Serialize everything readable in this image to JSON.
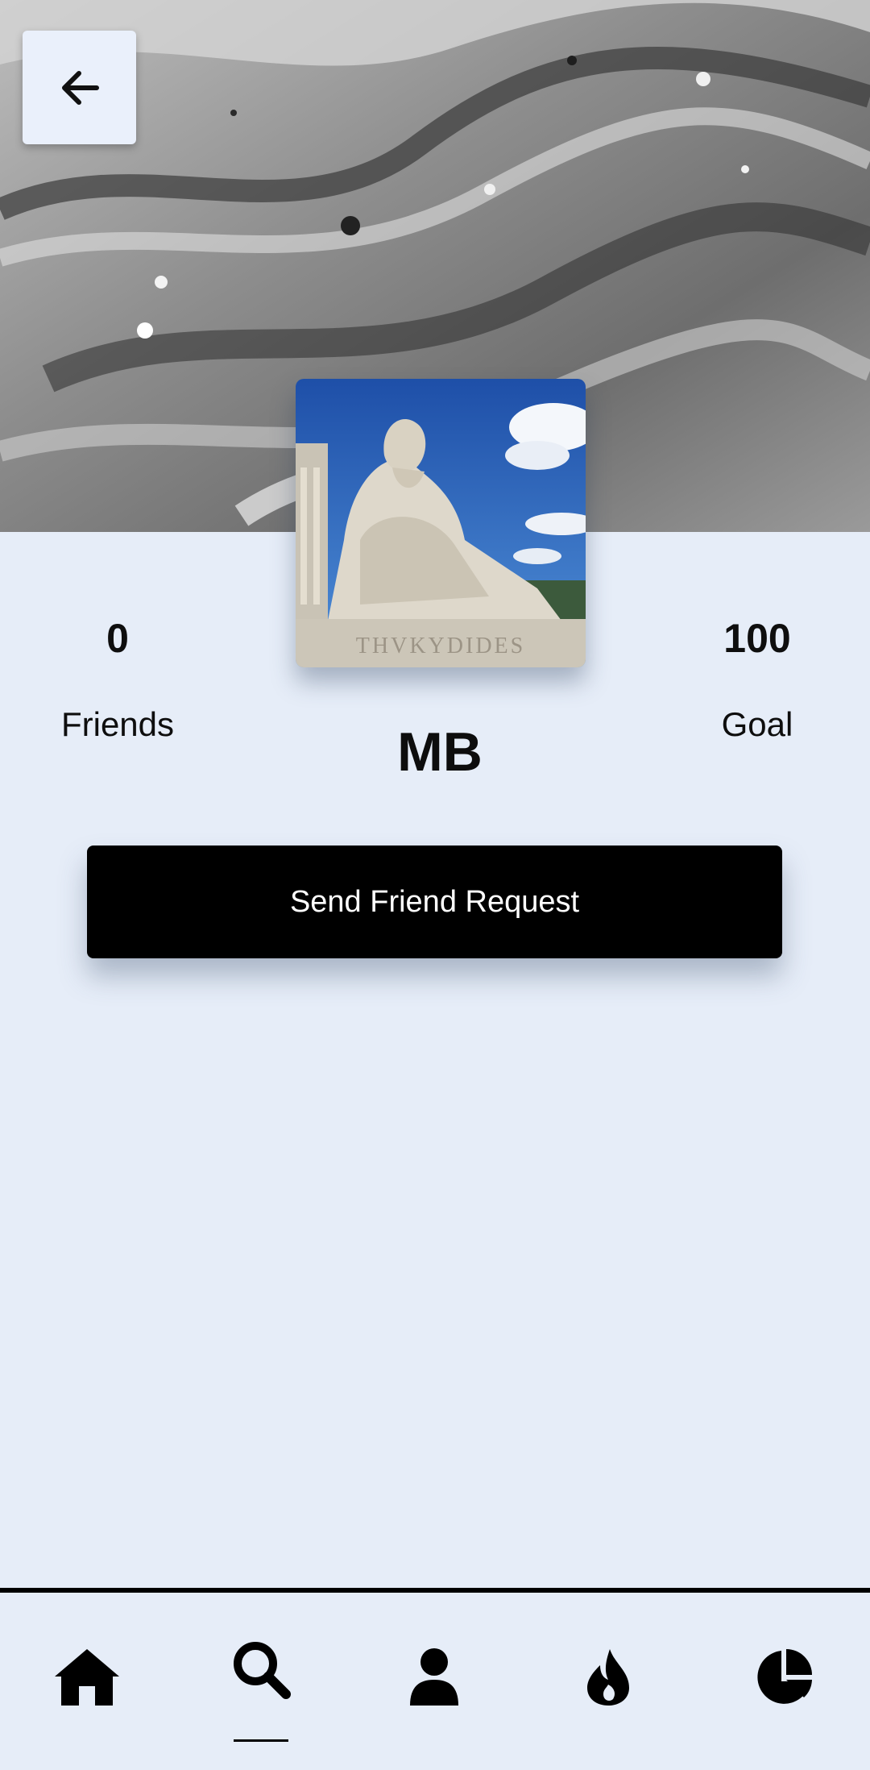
{
  "profile": {
    "name": "MB",
    "friends_count": "0",
    "friends_label": "Friends",
    "goal_count": "100",
    "goal_label": "Goal",
    "send_request_label": "Send Friend Request",
    "avatar_inscription": "THVKYDIDES"
  },
  "nav": {
    "items": [
      {
        "icon": "home-icon",
        "active": false
      },
      {
        "icon": "search-icon",
        "active": true
      },
      {
        "icon": "person-icon",
        "active": false
      },
      {
        "icon": "flame-icon",
        "active": false
      },
      {
        "icon": "pie-chart-icon",
        "active": false
      }
    ]
  },
  "colors": {
    "background": "#e6edf8",
    "button": "#000000",
    "button_text": "#ffffff"
  }
}
